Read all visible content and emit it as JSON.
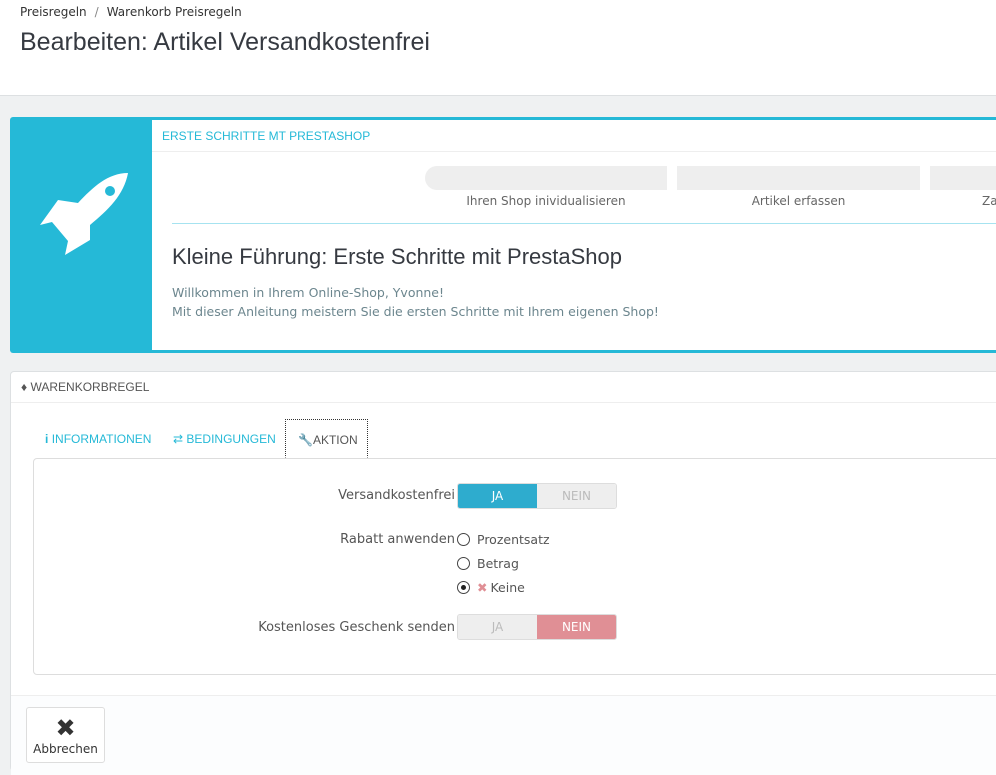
{
  "breadcrumb": [
    "Preisregeln",
    "Warenkorb Preisregeln"
  ],
  "page_title": "Bearbeiten: Artikel Versandkostenfrei",
  "onboarding": {
    "header": "ERSTE SCHRITTE MT PRESTASHOP",
    "steps": [
      "Ihren Shop inividualisieren",
      "Artikel erfassen",
      "Za"
    ],
    "title": "Kleine Führung: Erste Schritte mit PrestaShop",
    "line1": "Willkommen in Ihrem Online-Shop, Yvonne!",
    "line2": "Mit dieser Anleitung meistern Sie die ersten Schritte mit Ihrem eigenen Shop!",
    "accent": "#25b9d7"
  },
  "panel": {
    "title": "WARENKORBREGEL",
    "tabs": [
      {
        "label": "INFORMATIONEN",
        "icon": "info-icon"
      },
      {
        "label": "BEDINGUNGEN",
        "icon": "shuffle-icon"
      },
      {
        "label": "AKTION",
        "icon": "wrench-icon",
        "active": true
      }
    ],
    "free_shipping": {
      "label": "Versandkostenfrei",
      "yes": "JA",
      "no": "NEIN",
      "value": "JA"
    },
    "discount": {
      "label": "Rabatt anwenden",
      "options": [
        "Prozentsatz",
        "Betrag",
        "Keine"
      ],
      "selected": "Keine"
    },
    "gift": {
      "label": "Kostenloses Geschenk senden",
      "yes": "JA",
      "no": "NEIN",
      "value": "NEIN"
    },
    "cancel": "Abbrechen"
  }
}
